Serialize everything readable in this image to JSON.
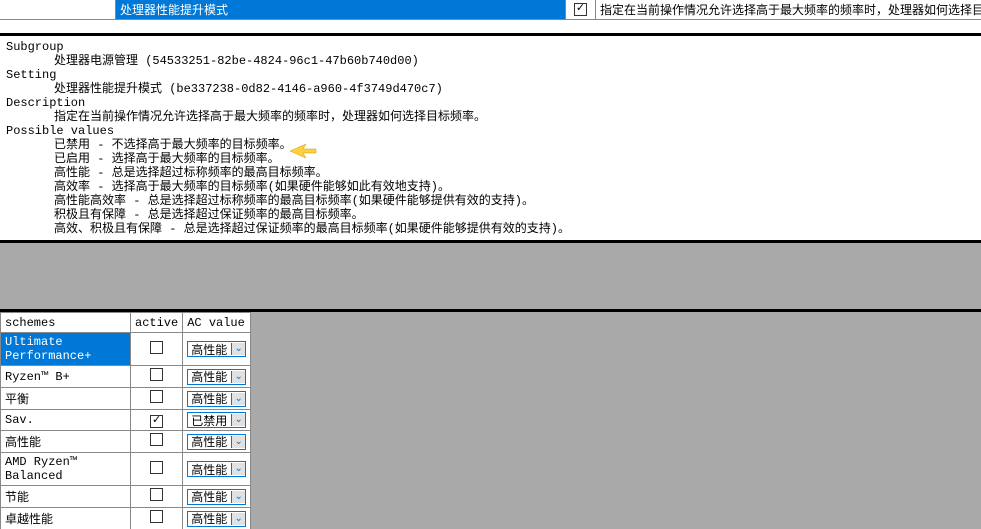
{
  "topRow": {
    "settingName": "处理器性能提升模式",
    "checked": true,
    "description": "指定在当前操作情况允许选择高于最大频率的频率时，处理器如何选择目"
  },
  "detail": {
    "subgroup_label": "Subgroup",
    "subgroup_value": "处理器电源管理 (54533251-82be-4824-96c1-47b60b740d00)",
    "setting_label": "Setting",
    "setting_value": "处理器性能提升模式 (be337238-0d82-4146-a960-4f3749d470c7)",
    "description_label": "Description",
    "description_value": "指定在当前操作情况允许选择高于最大频率的频率时，处理器如何选择目标频率。",
    "possible_values_label": "Possible values",
    "values": [
      "已禁用 - 不选择高于最大频率的目标频率。",
      "已启用 - 选择高于最大频率的目标频率。",
      "高性能 - 总是选择超过标称频率的最高目标频率。",
      "高效率 - 选择高于最大频率的目标频率(如果硬件能够如此有效地支持)。",
      "高性能高效率 - 总是选择超过标称频率的最高目标频率(如果硬件能够提供有效的支持)。",
      "积极且有保障 - 总是选择超过保证频率的最高目标频率。",
      "高效、积极且有保障 - 总是选择超过保证频率的最高目标频率(如果硬件能够提供有效的支持)。"
    ]
  },
  "gridHeaders": {
    "schemes": "schemes",
    "active": "active",
    "ac": "AC value"
  },
  "schemes": [
    {
      "name": "Ultimate Performance+",
      "active": false,
      "ac": "高性能",
      "selected": true
    },
    {
      "name": "Ryzen™ B+",
      "active": false,
      "ac": "高性能",
      "selected": false
    },
    {
      "name": "平衡",
      "active": false,
      "ac": "高性能",
      "selected": false
    },
    {
      "name": "Sav.",
      "active": true,
      "ac": "已禁用",
      "selected": false
    },
    {
      "name": "高性能",
      "active": false,
      "ac": "高性能",
      "selected": false
    },
    {
      "name": "AMD Ryzen™ Balanced",
      "active": false,
      "ac": "高性能",
      "selected": false
    },
    {
      "name": "节能",
      "active": false,
      "ac": "高性能",
      "selected": false
    },
    {
      "name": "卓越性能",
      "active": false,
      "ac": "高性能",
      "selected": false
    }
  ]
}
